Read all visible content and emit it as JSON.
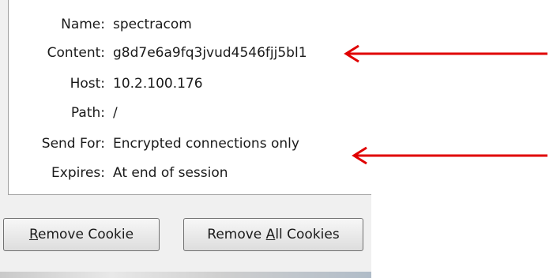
{
  "cookie_details": [
    {
      "label": "Name:",
      "value": "spectracom"
    },
    {
      "label": "Content:",
      "value": "g8d7e6a9fq3jvud4546fjj5bl1"
    },
    {
      "label": "Host:",
      "value": "10.2.100.176"
    },
    {
      "label": "Path:",
      "value": "/"
    },
    {
      "label": "Send For:",
      "value": "Encrypted connections only"
    },
    {
      "label": "Expires:",
      "value": "At end of session"
    }
  ],
  "buttons": {
    "remove_cookie": {
      "mnemonic": "R",
      "rest": "emove Cookie"
    },
    "remove_all": {
      "before": "Remove ",
      "mnemonic": "A",
      "after": "ll Cookies"
    }
  },
  "colors": {
    "annotation_arrow": "#e00000"
  }
}
